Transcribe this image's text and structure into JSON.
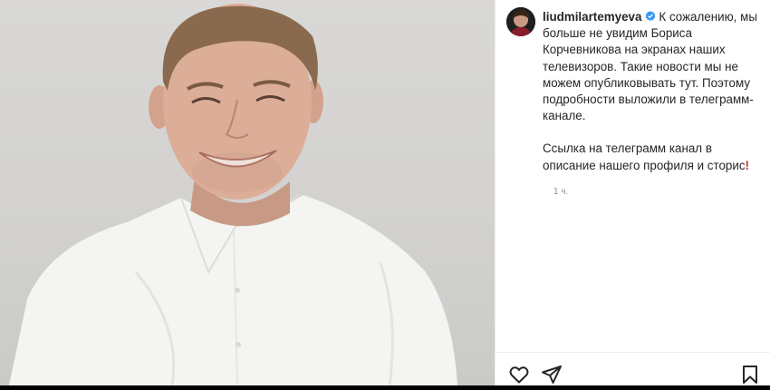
{
  "post": {
    "username": "liudmilartemyeva",
    "caption_paragraphs": [
      "К сожалению, мы больше не увидим Бориса Корчевникова на экранах наших телевизоров. Такие новости мы не можем опубликовывать тут. Поэтому подробности выложили в телеграмм-канале.",
      "Ссылка на телеграмм канал в описание нашего профиля и сторис"
    ],
    "caption_trailing_emoji": "!",
    "time_ago": "1 ч.",
    "verified": true
  },
  "icons": {
    "like": "heart-icon",
    "share": "paper-plane-icon",
    "save": "bookmark-icon",
    "verified": "verified-badge-icon"
  },
  "colors": {
    "verified_blue": "#3897f0",
    "text": "#262626",
    "muted": "#8e8e8e",
    "emoji_red": "#c0392b"
  }
}
